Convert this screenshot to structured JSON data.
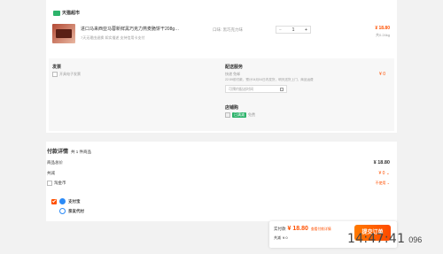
{
  "store": {
    "name": "天猫超市",
    "badge_icon": "tmall-icon"
  },
  "top_header_fragment": "",
  "product": {
    "title": "进口马来西亚马蓉新鲜黑巧克力燕麦脆饼干208g…",
    "service": "7天无理由退换  如实描述  支持信用卡支付",
    "spec": "口味: 黑巧克力味",
    "qty": "1",
    "minus": "−",
    "plus": "+",
    "price": "¥ 18.80",
    "subprice": "共0.24kg"
  },
  "invoice": {
    "title": "发票",
    "option": "开具电子发票"
  },
  "delivery": {
    "title": "配送服务",
    "type": "快递 免邮",
    "note": "22:59前付款，预计04月04日内发货，明天送货上门，商品运费",
    "time_placeholder": "可预约配送时间",
    "price": "¥ 0"
  },
  "coupon_shop": {
    "title": "店铺购",
    "badge": "已满减",
    "label": "免费"
  },
  "payment_detail": {
    "title": "付款详情",
    "count_text": "共 1 件商品",
    "rows": [
      {
        "label": "商品总价",
        "value": "¥ 18.80"
      },
      {
        "label": "共减",
        "value": "¥ 0"
      },
      {
        "label": "淘金币",
        "value": "不使用"
      }
    ]
  },
  "pay_methods": [
    {
      "label": "支付宝",
      "icon": "alipay-icon"
    },
    {
      "label": "亲友代付",
      "icon": "friend-pay-icon"
    }
  ],
  "footer": {
    "actual_label": "实付款",
    "actual_amount": "¥ 18.80",
    "view_link": "查看付款详情",
    "saved_label": "共减",
    "saved_amount": "¥ 0",
    "submit": "提交订单",
    "clock": "14:47:41",
    "clock_suffix": "096"
  },
  "colors": {
    "accent": "#ff5000",
    "green": "#2db36b",
    "blue": "#2b8af7"
  }
}
